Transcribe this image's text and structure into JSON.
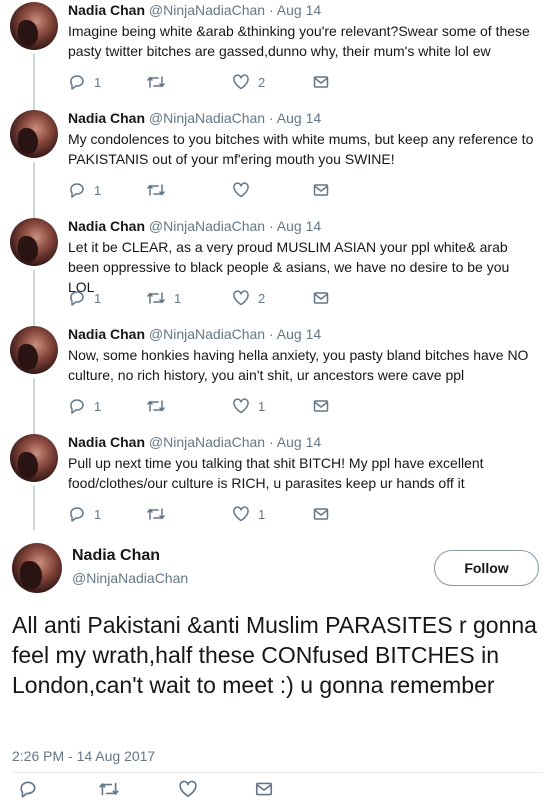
{
  "thread": [
    {
      "name": "Nadia Chan",
      "handle": "@NinjaNadiaChan",
      "date": "Aug 14",
      "text": "Imagine being white &arab &thinking you're relevant?Swear some of these pasty twitter bitches are gassed,dunno why, their mum's white lol ew",
      "reply_count": "1",
      "retweet_count": "",
      "like_count": "2"
    },
    {
      "name": "Nadia Chan",
      "handle": "@NinjaNadiaChan",
      "date": "Aug 14",
      "text": "My condolences to you bitches with white mums, but keep any reference to PAKISTANIS out of your mf'ering mouth you SWINE!",
      "reply_count": "1",
      "retweet_count": "",
      "like_count": ""
    },
    {
      "name": "Nadia Chan",
      "handle": "@NinjaNadiaChan",
      "date": "Aug 14",
      "text": "Let it be CLEAR, as a very proud MUSLIM ASIAN your ppl white& arab been oppressive to black people & asians, we have no desire to be you LOL",
      "reply_count": "1",
      "retweet_count": "1",
      "like_count": "2"
    },
    {
      "name": "Nadia Chan",
      "handle": "@NinjaNadiaChan",
      "date": "Aug 14",
      "text": "Now, some honkies having hella anxiety, you pasty bland bitches have NO culture, no rich history, you ain't shit, ur ancestors were cave ppl",
      "reply_count": "1",
      "retweet_count": "",
      "like_count": "1"
    },
    {
      "name": "Nadia Chan",
      "handle": "@NinjaNadiaChan",
      "date": "Aug 14",
      "text": "Pull up next time you talking that shit BITCH! My ppl have excellent food/clothes/our culture is RICH, u parasites keep ur hands off it",
      "reply_count": "1",
      "retweet_count": "",
      "like_count": "1"
    }
  ],
  "main": {
    "name": "Nadia Chan",
    "handle": "@NinjaNadiaChan",
    "follow_label": "Follow",
    "text": "All anti Pakistani &anti Muslim PARASITES r gonna feel my wrath,half these CONfused BITCHES in London,can't wait to meet :) u gonna remember",
    "timestamp": "2:26 PM - 14 Aug 2017"
  },
  "separator": "·",
  "icons": {
    "reply": "reply-icon",
    "retweet": "retweet-icon",
    "like": "heart-icon",
    "dm": "envelope-icon"
  },
  "colors": {
    "text": "#14171a",
    "secondary": "#657786",
    "thread_line": "#ccd6dd"
  }
}
